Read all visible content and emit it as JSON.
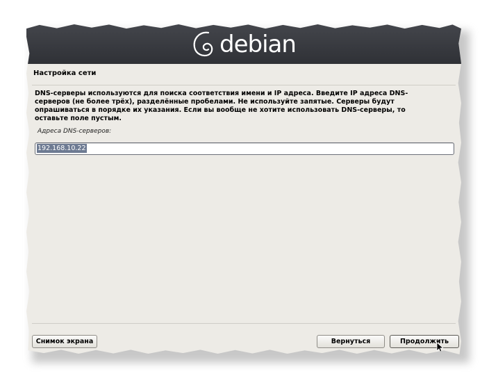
{
  "header": {
    "logo_text": "debian"
  },
  "page": {
    "section_title": "Настройка сети",
    "description": "DNS-серверы используются для поиска соответствия имени и IP адреса. Введите IP адреса DNS-серверов (не более трёх), разделённые пробелами. Не используйте запятые. Серверы будут опрашиваться в порядке их указания. Если вы вообще не хотите использовать DNS-серверы, то оставьте поле пустым.",
    "field_label": "Адреса DNS-серверов:",
    "field_value": "192.168.10.22"
  },
  "buttons": {
    "screenshot": "Снимок экрана",
    "back": "Вернуться",
    "continue": "Продолжить"
  },
  "colors": {
    "banner": "#3a3c41",
    "background": "#edebe6",
    "selection": "#6d7a92"
  }
}
